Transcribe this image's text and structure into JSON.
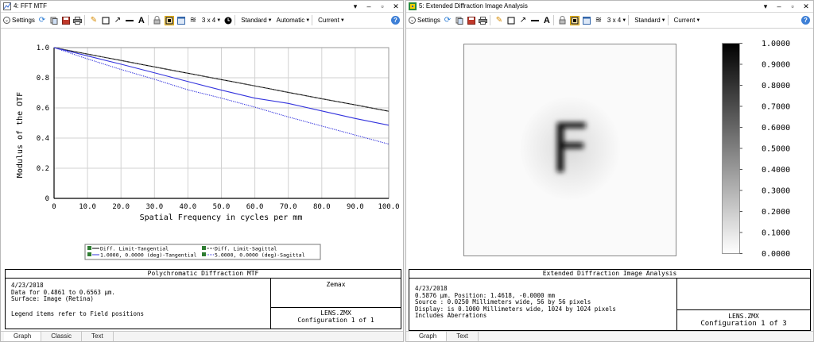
{
  "left_window": {
    "title": "4: FFT MTF",
    "toolbar": {
      "settings_label": "Settings",
      "layout_label": "3 x 4",
      "standard_label": "Standard",
      "automatic_label": "Automatic",
      "current_label": "Current"
    },
    "tabs": [
      "Graph",
      "Classic",
      "Text"
    ],
    "active_tab": "Graph",
    "legend": {
      "items": [
        "Diff. Limit-Tangential",
        "Diff. Limit-Sagittal",
        "1.0000, 0.0000 (deg)-Tangential",
        "5.0000, 0.0000 (deg)-Sagittal"
      ]
    },
    "info": {
      "title": "Polychromatic Diffraction MTF",
      "date": "4/23/2018",
      "line1": "Data for 0.4861 to 0.6563 µm.",
      "line2": "Surface: Image (Retina)",
      "line3": "Legend items refer to Field positions",
      "company": "Zemax",
      "file": "LENS.ZMX",
      "config": "Configuration 1 of 1"
    }
  },
  "chart_data": {
    "type": "line",
    "title": "",
    "xlabel": "Spatial Frequency in cycles per mm",
    "ylabel": "Modulus of the OTF",
    "xlim": [
      0,
      100
    ],
    "ylim": [
      0,
      1.0
    ],
    "x_ticks": [
      "0",
      "10.0",
      "20.0",
      "30.0",
      "40.0",
      "50.0",
      "60.0",
      "70.0",
      "80.0",
      "90.0",
      "100.0"
    ],
    "y_ticks": [
      "0",
      "0.2",
      "0.4",
      "0.6",
      "0.8",
      "1.0"
    ],
    "grid": true,
    "legend_placement": "bottom",
    "series": [
      {
        "name": "Diff. Limit-Tangential",
        "color": "#000000",
        "style": "solid",
        "x": [
          0,
          10,
          20,
          30,
          40,
          50,
          60,
          70,
          80,
          90,
          100
        ],
        "y": [
          1.0,
          0.957,
          0.915,
          0.872,
          0.83,
          0.788,
          0.746,
          0.703,
          0.661,
          0.62,
          0.578
        ]
      },
      {
        "name": "Diff. Limit-Sagittal",
        "color": "#555555",
        "style": "dashed",
        "x": [
          0,
          10,
          20,
          30,
          40,
          50,
          60,
          70,
          80,
          90,
          100
        ],
        "y": [
          1.0,
          0.957,
          0.915,
          0.872,
          0.83,
          0.788,
          0.746,
          0.703,
          0.661,
          0.62,
          0.578
        ]
      },
      {
        "name": "1.0000, 0.0000 (deg)-Tangential",
        "color": "#3333dd",
        "style": "solid",
        "x": [
          0,
          10,
          20,
          30,
          40,
          50,
          60,
          70,
          80,
          90,
          100
        ],
        "y": [
          1.0,
          0.945,
          0.89,
          0.833,
          0.775,
          0.718,
          0.665,
          0.63,
          0.58,
          0.53,
          0.485
        ]
      },
      {
        "name": "5.0000, 0.0000 (deg)-Sagittal",
        "color": "#3333dd",
        "style": "dotted",
        "x": [
          0,
          10,
          20,
          30,
          40,
          50,
          60,
          70,
          80,
          90,
          100
        ],
        "y": [
          1.0,
          0.925,
          0.855,
          0.79,
          0.72,
          0.665,
          0.605,
          0.54,
          0.48,
          0.42,
          0.36
        ]
      }
    ]
  },
  "right_window": {
    "title": "5: Extended Diffraction Image Analysis",
    "toolbar": {
      "settings_label": "Settings",
      "layout_label": "3 x 4",
      "standard_label": "Standard",
      "current_label": "Current"
    },
    "tabs": [
      "Graph",
      "Text"
    ],
    "active_tab": "Graph",
    "image_letter": "F",
    "colorbar_ticks": [
      "1.0000",
      "0.9000",
      "0.8000",
      "0.7000",
      "0.6000",
      "0.5000",
      "0.4000",
      "0.3000",
      "0.2000",
      "0.1000",
      "0.0000"
    ],
    "info": {
      "title": "Extended Diffraction Image Analysis",
      "date": "4/23/2018",
      "line1": "0.5876 µm. Position: 1.4618, -0.0000 mm",
      "line2": "Source : 0.0250 Millimeters wide, 56 by 56 pixels",
      "line3": "Display: is 0.1000 Millimeters wide, 1024 by 1024 pixels",
      "line4": "Includes Aberrations",
      "file": "LENS.ZMX",
      "config": "Configuration 1 of 3"
    }
  }
}
